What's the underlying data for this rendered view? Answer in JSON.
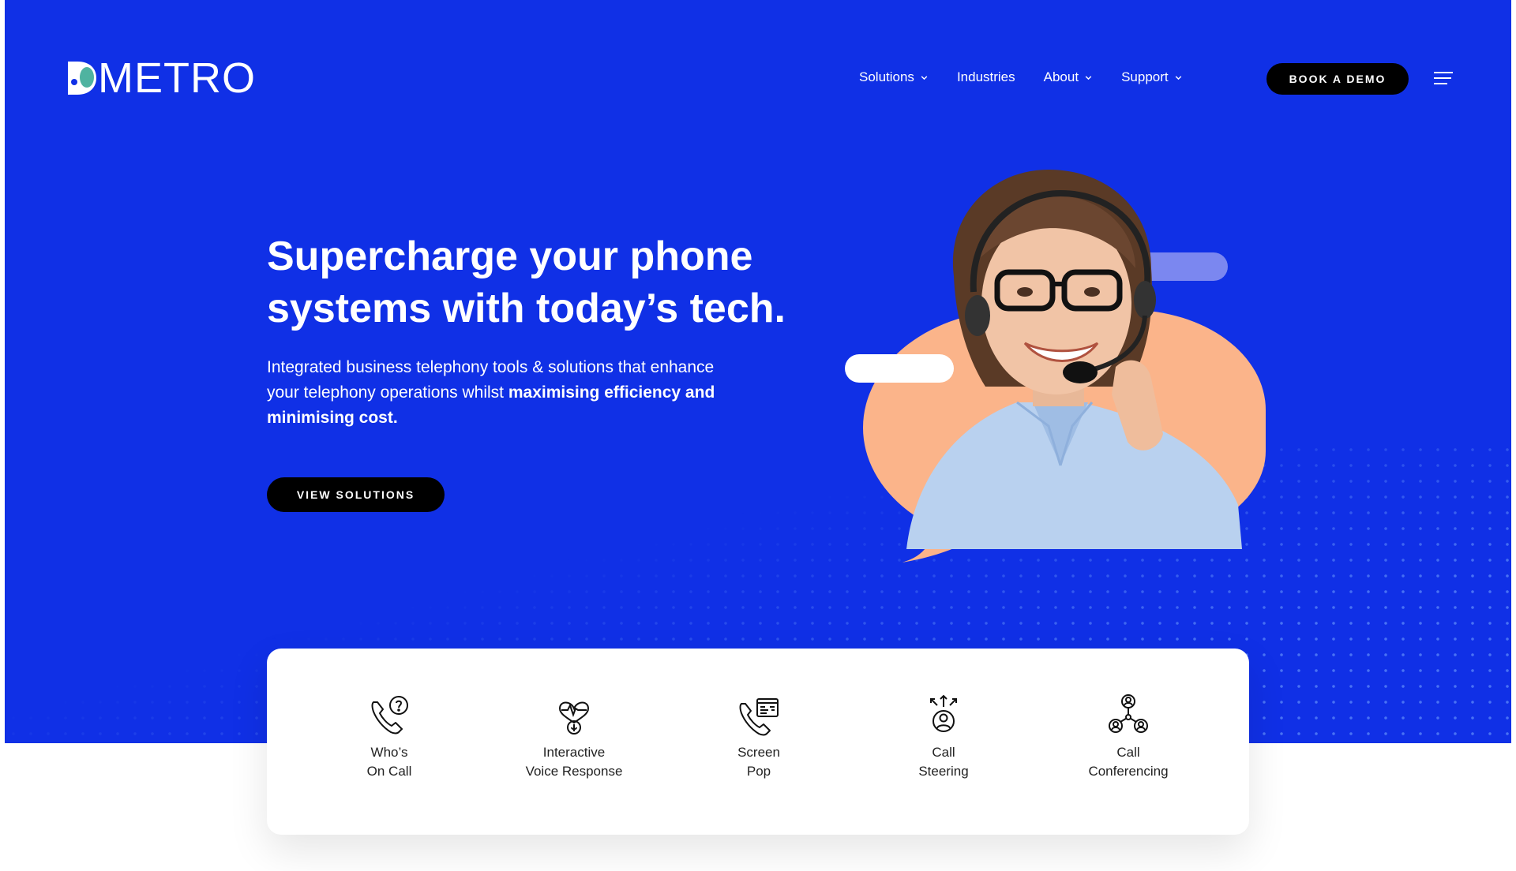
{
  "brand": {
    "name": "METRO",
    "logo_icon": "phone-chat-logo-icon"
  },
  "nav": {
    "items": [
      {
        "label": "Solutions",
        "has_dropdown": true
      },
      {
        "label": "Industries",
        "has_dropdown": false
      },
      {
        "label": "About",
        "has_dropdown": true
      },
      {
        "label": "Support",
        "has_dropdown": true
      }
    ],
    "book_demo_label": "BOOK A DEMO",
    "menu_icon": "hamburger-menu-icon"
  },
  "hero": {
    "headline_line1": "Supercharge your phone",
    "headline_line2": "systems with today’s tech.",
    "subtitle_plain": "Integrated business telephony tools & solutions that enhance your telephony operations whilst ",
    "subtitle_bold": "maximising efficiency and minimising cost.",
    "cta_label": "VIEW SOLUTIONS"
  },
  "features": [
    {
      "line1": "Who’s",
      "line2": "On Call",
      "icon": "phone-question-icon"
    },
    {
      "line1": "Interactive",
      "line2": "Voice Response",
      "icon": "voice-heartbeat-icon"
    },
    {
      "line1": "Screen",
      "line2": "Pop",
      "icon": "phone-screen-icon"
    },
    {
      "line1": "Call",
      "line2": "Steering",
      "icon": "call-steering-icon"
    },
    {
      "line1": "Call",
      "line2": "Conferencing",
      "icon": "conference-users-icon"
    }
  ],
  "colors": {
    "hero_bg": "#1030e6",
    "blob": "#fbb48a",
    "pill": "#7b87f0",
    "button": "#000000"
  }
}
